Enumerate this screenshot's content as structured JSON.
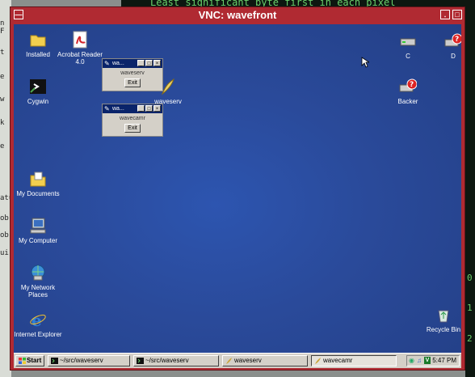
{
  "host": {
    "top_text": "Least significant byte first in each pixel",
    "left_fragments": [
      "n F",
      "t",
      "e",
      "w",
      "k",
      "e",
      "atu",
      "ob",
      "ob",
      "ui"
    ],
    "right_fragments": [
      "0",
      "1",
      "2"
    ]
  },
  "window": {
    "title": "VNC: wavefront",
    "accent_color": "#b02a32",
    "desktop_color": "#2a4a9a"
  },
  "desktop_icons": [
    {
      "name": "installed",
      "label": "Installed",
      "icon": "folder-icon"
    },
    {
      "name": "acrobat",
      "label": "Acrobat Reader 4.0",
      "icon": "acrobat-icon"
    },
    {
      "name": "cygwin",
      "label": "Cygwin",
      "icon": "cygwin-icon"
    },
    {
      "name": "waveserv",
      "label": "waveserv",
      "icon": "feather-icon"
    },
    {
      "name": "my-documents",
      "label": "My Documents",
      "icon": "documents-folder-icon"
    },
    {
      "name": "my-computer",
      "label": "My Computer",
      "icon": "computer-icon"
    },
    {
      "name": "network-places",
      "label": "My Network Places",
      "icon": "network-icon"
    },
    {
      "name": "ie",
      "label": "Internet Explorer",
      "icon": "ie-icon"
    },
    {
      "name": "drive-c",
      "label": "C",
      "icon": "drive-icon"
    },
    {
      "name": "drive-d",
      "label": "D",
      "icon": "drive-missing-icon"
    },
    {
      "name": "backer",
      "label": "Backer",
      "icon": "drive-missing-icon"
    },
    {
      "name": "recycle-bin",
      "label": "Recycle Bin",
      "icon": "recycle-bin-icon"
    }
  ],
  "app_windows": [
    {
      "title": "wa...",
      "label": "waveserv",
      "button": "Exit"
    },
    {
      "title": "wa...",
      "label": "wavecamr",
      "button": "Exit"
    }
  ],
  "taskbar": {
    "start": "Start",
    "items": [
      {
        "label": "~/src/waveserv",
        "icon": "terminal-icon",
        "active": false
      },
      {
        "label": "~/src/waveserv",
        "icon": "terminal-icon",
        "active": false
      },
      {
        "label": "waveserv",
        "icon": "feather-icon",
        "active": false
      },
      {
        "label": "wavecamr",
        "icon": "feather-icon",
        "active": true
      }
    ],
    "clock": "5:47 PM"
  }
}
